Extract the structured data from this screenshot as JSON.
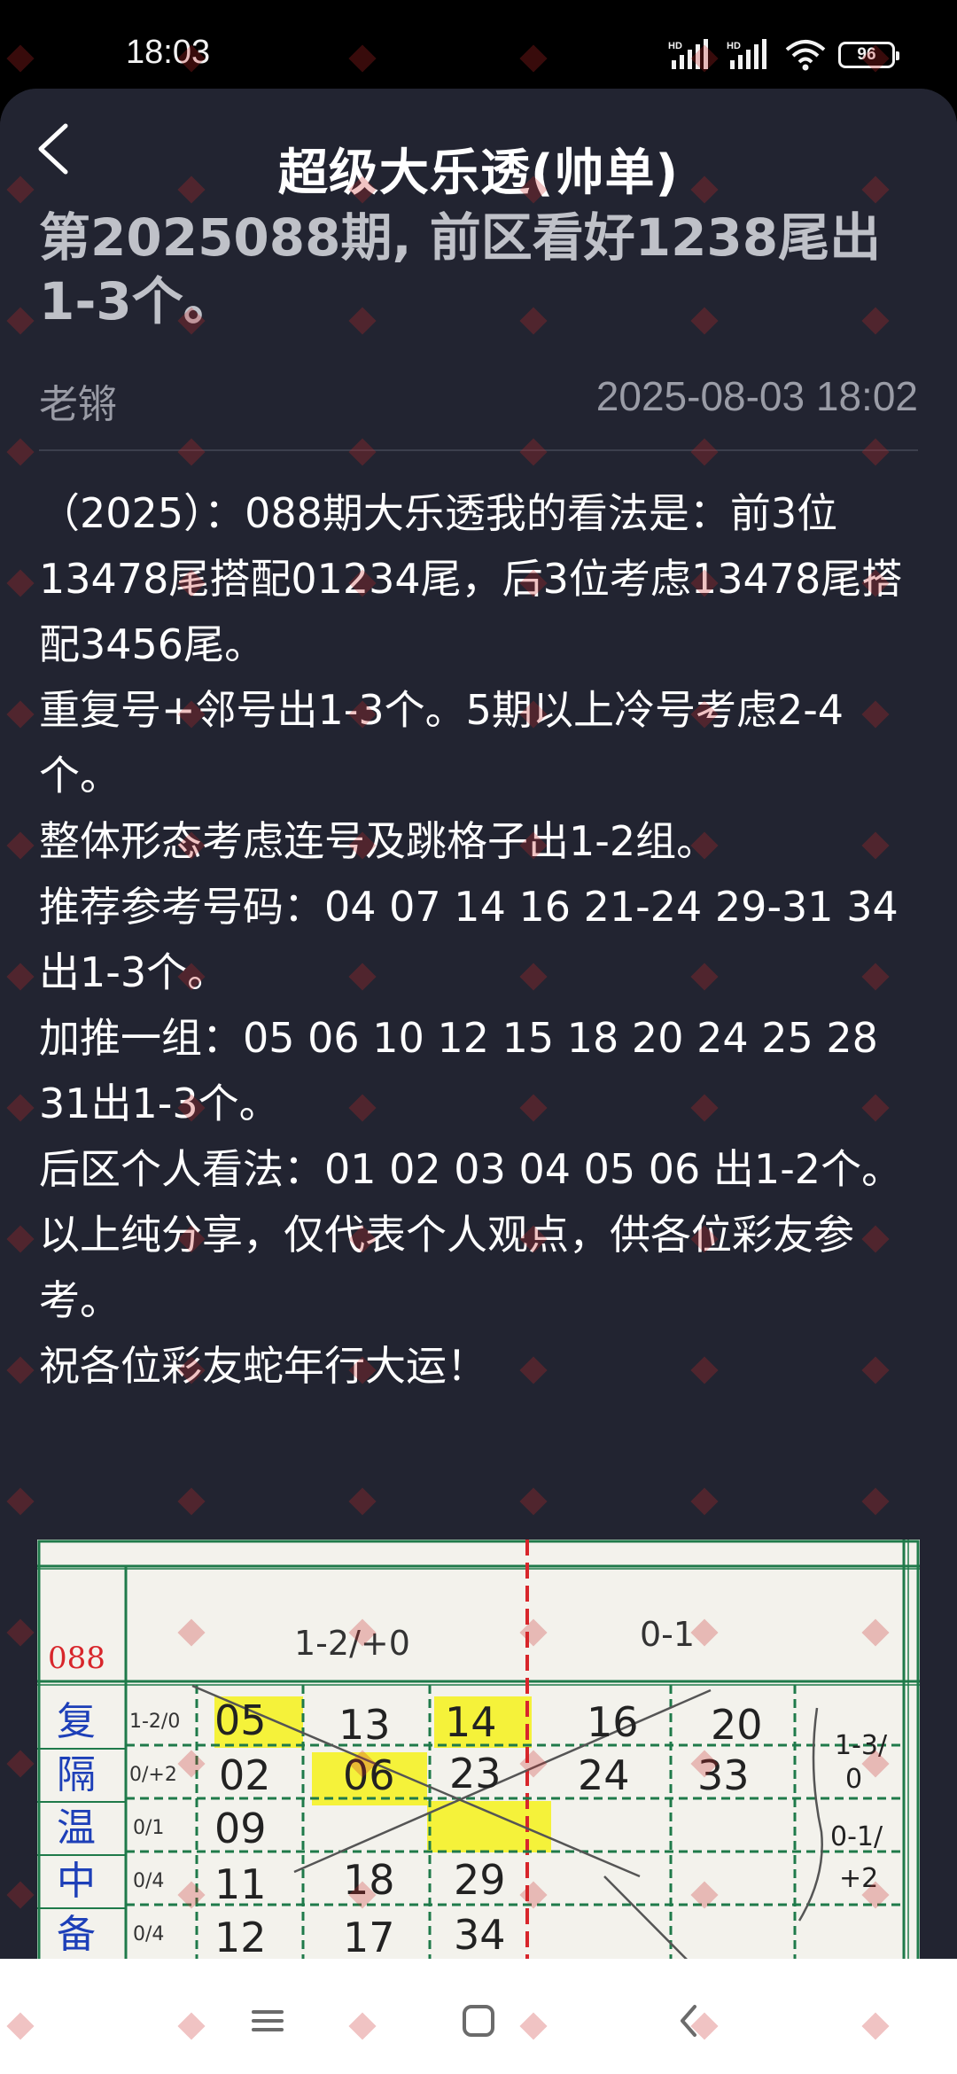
{
  "status_bar": {
    "time": "18:03",
    "battery": "96",
    "icons": [
      "hd-signal-icon",
      "hd-signal-icon",
      "wifi-icon",
      "battery-icon"
    ]
  },
  "header": {
    "back_icon": "chevron-left-icon",
    "title": "超级大乐透(帅单)"
  },
  "post": {
    "title": "第2025088期, 前区看好1238尾出1-3个。",
    "author": "老锵",
    "time": "2025-08-03 18:02",
    "body": [
      "（2025）：088期大乐透我的看法是：前3位13478尾搭配01234尾，后3位考虑13478尾搭配3456尾。",
      "重复号+邻号出1-3个。5期以上冷号考虑2-4个。",
      "整体形态考虑连号及跳格子出1-2组。",
      "推荐参考号码：04 07 14 16 21-24 29-31 34出1-3个。",
      "加推一组：05 06 10 12 15 18 20 24 25 28 31出1-3个。",
      "后区个人看法：01 02 03 04 05 06 出1-2个。",
      "以上纯分享，仅代表个人观点，供各位彩友参考。",
      "祝各位彩友蛇年行大运！"
    ]
  },
  "image": {
    "issue": "088",
    "header_left": "1-2/+0",
    "header_right": "0-1",
    "row_labels": [
      "复",
      "隔",
      "温",
      "中",
      "备"
    ],
    "row_ratios": [
      "1-2/0",
      "0/+2",
      "0/1",
      "0/4",
      "0/4"
    ],
    "numbers_row1": [
      "05",
      "13",
      "14",
      "16",
      "20"
    ],
    "numbers_row2": [
      "02",
      "06",
      "23",
      "24",
      "33"
    ],
    "numbers_row3": [
      "09"
    ],
    "numbers_row4": [
      "11",
      "18",
      "29"
    ],
    "numbers_row5": [
      "12",
      "17",
      "34"
    ],
    "side_notes": [
      "1-3/0",
      "0-1/+2"
    ]
  },
  "bottom_nav": {
    "icons": [
      "menu-icon",
      "home-square-icon",
      "back-chevron-icon"
    ]
  },
  "colors": {
    "sheet_bg": "#222431",
    "highlight": "#f5f23a",
    "grid_green": "#1f7a4a",
    "red_line": "#d8262b",
    "label_blue": "#1d3fb8"
  }
}
